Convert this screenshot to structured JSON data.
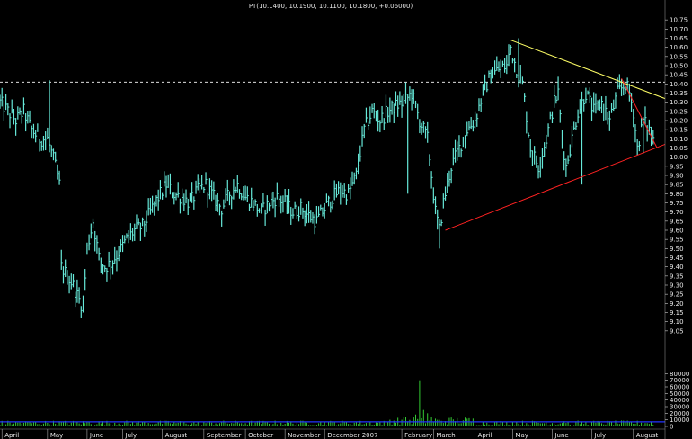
{
  "title": "PT(10.1400, 10.1900, 10.1100, 10.1800, +0.06000)",
  "colors": {
    "background": "#000000",
    "price": "#66e8d8",
    "volume": "#33cc33",
    "axis_text": "#e8e8e8",
    "resistance_line": "#ffff66",
    "support_line": "#ff2222",
    "volume_baseline": "#2233ff",
    "dashed_level": "#ffffff"
  },
  "chart_data": [
    {
      "type": "ohlc",
      "name": "price",
      "ylim": [
        9.0,
        10.8
      ],
      "y_ticks": [
        9.05,
        9.1,
        9.15,
        9.2,
        9.25,
        9.3,
        9.35,
        9.4,
        9.45,
        9.5,
        9.55,
        9.6,
        9.65,
        9.7,
        9.75,
        9.8,
        9.85,
        9.9,
        9.95,
        10.0,
        10.05,
        10.1,
        10.15,
        10.2,
        10.25,
        10.3,
        10.35,
        10.4,
        10.45,
        10.5,
        10.55,
        10.6,
        10.65,
        10.7,
        10.75
      ],
      "x_labels": [
        {
          "label": "April",
          "index": 1
        },
        {
          "label": "May",
          "index": 24
        },
        {
          "label": "June",
          "index": 44
        },
        {
          "label": "July",
          "index": 62
        },
        {
          "label": "August",
          "index": 82
        },
        {
          "label": "September",
          "index": 103
        },
        {
          "label": "October",
          "index": 124
        },
        {
          "label": "November",
          "index": 144
        },
        {
          "label": "December 2007",
          "index": 164
        },
        {
          "label": "February",
          "index": 203
        },
        {
          "label": "March",
          "index": 219
        },
        {
          "label": "April",
          "index": 240
        },
        {
          "label": "May",
          "index": 259
        },
        {
          "label": "June",
          "index": 279
        },
        {
          "label": "July",
          "index": 299
        },
        {
          "label": "August",
          "index": 320
        }
      ],
      "key_points": [
        [
          0,
          10.3
        ],
        [
          4,
          10.25
        ],
        [
          8,
          10.2
        ],
        [
          12,
          10.25
        ],
        [
          16,
          10.15
        ],
        [
          20,
          10.1
        ],
        [
          24,
          10.1
        ],
        [
          28,
          9.95
        ],
        [
          30,
          9.85
        ],
        [
          31,
          9.4
        ],
        [
          34,
          9.35
        ],
        [
          37,
          9.3
        ],
        [
          40,
          9.22
        ],
        [
          42,
          9.18
        ],
        [
          44,
          9.5
        ],
        [
          47,
          9.65
        ],
        [
          50,
          9.45
        ],
        [
          53,
          9.4
        ],
        [
          56,
          9.42
        ],
        [
          60,
          9.48
        ],
        [
          64,
          9.55
        ],
        [
          68,
          9.6
        ],
        [
          72,
          9.62
        ],
        [
          76,
          9.7
        ],
        [
          80,
          9.78
        ],
        [
          84,
          9.85
        ],
        [
          88,
          9.8
        ],
        [
          92,
          9.78
        ],
        [
          96,
          9.75
        ],
        [
          100,
          9.82
        ],
        [
          104,
          9.85
        ],
        [
          108,
          9.78
        ],
        [
          112,
          9.72
        ],
        [
          116,
          9.8
        ],
        [
          120,
          9.85
        ],
        [
          124,
          9.78
        ],
        [
          128,
          9.75
        ],
        [
          132,
          9.7
        ],
        [
          136,
          9.75
        ],
        [
          140,
          9.78
        ],
        [
          144,
          9.75
        ],
        [
          148,
          9.7
        ],
        [
          152,
          9.72
        ],
        [
          156,
          9.68
        ],
        [
          160,
          9.65
        ],
        [
          164,
          9.72
        ],
        [
          168,
          9.78
        ],
        [
          172,
          9.82
        ],
        [
          176,
          9.8
        ],
        [
          180,
          9.9
        ],
        [
          184,
          10.15
        ],
        [
          188,
          10.25
        ],
        [
          192,
          10.2
        ],
        [
          196,
          10.25
        ],
        [
          200,
          10.28
        ],
        [
          204,
          10.3
        ],
        [
          208,
          10.35
        ],
        [
          212,
          10.2
        ],
        [
          216,
          10.1
        ],
        [
          218,
          9.9
        ],
        [
          220,
          9.7
        ],
        [
          222,
          9.6
        ],
        [
          224,
          9.75
        ],
        [
          228,
          9.95
        ],
        [
          232,
          10.05
        ],
        [
          236,
          10.15
        ],
        [
          240,
          10.2
        ],
        [
          244,
          10.35
        ],
        [
          248,
          10.45
        ],
        [
          252,
          10.48
        ],
        [
          256,
          10.5
        ],
        [
          258,
          10.6
        ],
        [
          260,
          10.52
        ],
        [
          262,
          10.45
        ],
        [
          264,
          10.4
        ],
        [
          268,
          10.05
        ],
        [
          272,
          9.95
        ],
        [
          276,
          10.1
        ],
        [
          280,
          10.3
        ],
        [
          282,
          10.35
        ],
        [
          284,
          10.1
        ],
        [
          286,
          9.95
        ],
        [
          288,
          10.05
        ],
        [
          292,
          10.25
        ],
        [
          296,
          10.35
        ],
        [
          300,
          10.25
        ],
        [
          304,
          10.3
        ],
        [
          308,
          10.2
        ],
        [
          312,
          10.35
        ],
        [
          316,
          10.4
        ],
        [
          318,
          10.35
        ],
        [
          320,
          10.25
        ],
        [
          322,
          10.05
        ],
        [
          325,
          10.2
        ],
        [
          328,
          10.15
        ],
        [
          330,
          10.1
        ]
      ],
      "spikes": [
        [
          25,
          10.42
        ],
        [
          42,
          9.15
        ],
        [
          206,
          9.8
        ],
        [
          222,
          9.5
        ],
        [
          262,
          10.65
        ],
        [
          294,
          9.85
        ],
        [
          325,
          10.02
        ]
      ],
      "last_close": 10.18,
      "index_range": [
        0,
        336
      ]
    },
    {
      "type": "bar",
      "name": "volume",
      "ylim": [
        0,
        90000
      ],
      "y_ticks": [
        0,
        10000,
        20000,
        30000,
        40000,
        50000,
        60000,
        70000,
        80000
      ],
      "y_tick_labels": [
        "0",
        "10000",
        "20000",
        "30000",
        "40000",
        "50000",
        "60000",
        "70000",
        "80000"
      ],
      "baseline_value": 7000,
      "typical_value": 6000,
      "peaks": [
        [
          205,
          15000
        ],
        [
          210,
          18000
        ],
        [
          212,
          70000
        ],
        [
          214,
          25000
        ],
        [
          216,
          20000
        ],
        [
          218,
          15000
        ],
        [
          222,
          10000
        ],
        [
          230,
          8000
        ],
        [
          285,
          8000
        ]
      ]
    }
  ],
  "trendlines": [
    {
      "name": "resistance",
      "from": [
        258,
        10.64
      ],
      "to": [
        336,
        10.32
      ]
    },
    {
      "name": "support",
      "from": [
        225,
        9.6
      ],
      "to": [
        336,
        10.07
      ]
    },
    {
      "name": "upper-wedge",
      "from": [
        314,
        10.43
      ],
      "to": [
        332,
        10.05
      ]
    }
  ],
  "horizontal_level": 10.41
}
